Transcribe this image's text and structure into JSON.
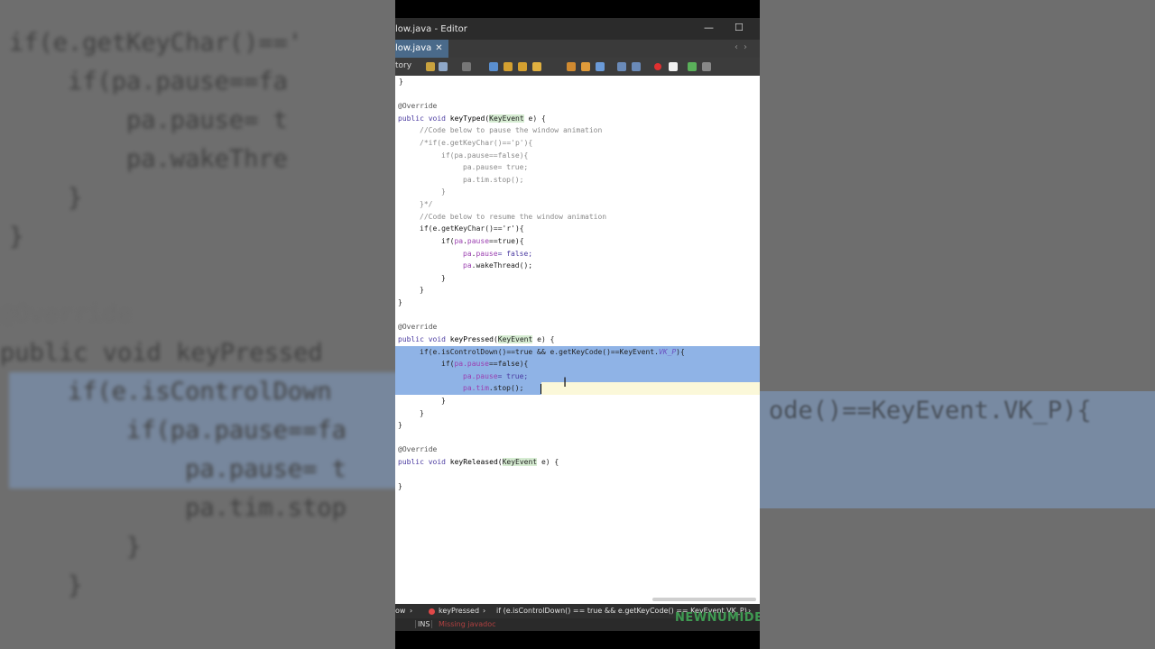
{
  "window": {
    "title": "low.java - Editor",
    "minimize": "—",
    "maximize": "☐"
  },
  "tab": {
    "label": "low.java",
    "close": "✕"
  },
  "toolbar": {
    "label": "tory"
  },
  "code": {
    "l0": "}",
    "l2": "@Override",
    "l3a": "public void ",
    "l3b": "keyTyped(",
    "l3c": "KeyEvent",
    "l3d": " e) {",
    "l4": "//Code below to pause the window animation",
    "l5": "/*if(e.getKeyChar()=='p'){",
    "l6": "if(pa.pause==false){",
    "l7": "pa.pause= true;",
    "l8": "pa.tim.stop();",
    "l9": "}",
    "l10": "}*/",
    "l11": "//Code below to resume the window animation",
    "l12": "if(e.getKeyChar()=='r'){",
    "l13a": "if(",
    "l13b": "pa",
    "l13c": ".",
    "l13d": "pause",
    "l13e": "==true){",
    "l14a": "pa",
    "l14b": ".",
    "l14c": "pause",
    "l14d": "= false;",
    "l15a": "pa",
    "l15b": ".wakeThread();",
    "l16": "}",
    "l17": "}",
    "l18": "}",
    "l20": "@Override",
    "l21a": "public void ",
    "l21b": "keyPressed(",
    "l21c": "KeyEvent",
    "l21d": " e) {",
    "l22a": "if(e.isControlDown()==true && e.getKeyCode()==KeyEvent.",
    "l22b": "VK_P",
    "l22c": "){",
    "l23a": "if(",
    "l23b": "pa.pause",
    "l23c": "==false){",
    "l24a": "pa.pause",
    "l24b": "= true;",
    "l25a": "pa.tim",
    "l25b": ".stop();",
    "l26": "}",
    "l27": "}",
    "l28": "}",
    "l30": "@Override",
    "l31a": "public void ",
    "l31b": "keyReleased(",
    "l31c": "KeyEvent",
    "l31d": " e) {",
    "l33": "}"
  },
  "breadcrumb": {
    "file": "ow",
    "method": "keyPressed",
    "stmt": "if (e.isControlDown() == true && e.getKeyCode() == KeyEvent.VK_P)"
  },
  "status": {
    "mode": "INS",
    "message": "Missing javadoc"
  },
  "watermark": "NEWNUMIDE",
  "background": {
    "l0": "if(e.getKeyChar()=='",
    "l1": "    if(pa.pause==fa",
    "l2": "        pa.pause= t",
    "l3": "        pa.wakeThre",
    "l4": "    }",
    "l5": "}",
    "l6": "",
    "l7": "@Override",
    "l8": "public void keyPressed",
    "l9": "    if(e.isControlDown",
    "l10": "        if(pa.pause==fa",
    "l11": "            pa.pause= t",
    "l12": "            pa.tim.stop",
    "l13": "        }",
    "l14": "    }",
    "r9": "ode()==KeyEvent.VK_P){"
  }
}
